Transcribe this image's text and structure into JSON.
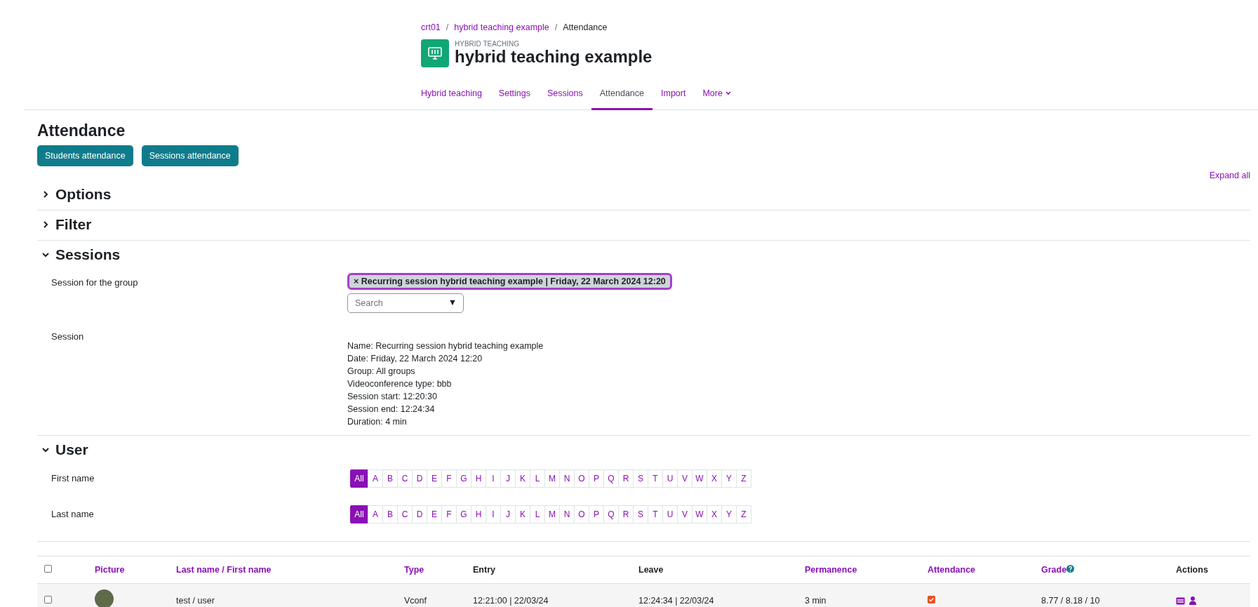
{
  "breadcrumb": [
    {
      "text": "crt01",
      "link": true
    },
    {
      "separator": "/",
      "text": "hybrid teaching example",
      "link": true
    },
    {
      "separator": "/",
      "text": "Attendance",
      "link": false
    }
  ],
  "module": {
    "kind_label": "HYBRID TEACHING",
    "title": "hybrid teaching example"
  },
  "nav": [
    {
      "label": "Hybrid teaching",
      "selected": false,
      "dropdown": false
    },
    {
      "label": "Settings",
      "selected": false,
      "dropdown": false
    },
    {
      "label": "Sessions",
      "selected": false,
      "dropdown": false
    },
    {
      "label": "Attendance",
      "selected": true,
      "dropdown": false
    },
    {
      "label": "Import",
      "selected": false,
      "dropdown": false
    },
    {
      "label": "More",
      "selected": false,
      "dropdown": true
    }
  ],
  "page_title": "Attendance",
  "buttons": [
    "Students attendance",
    "Sessions attendance"
  ],
  "expand_all": "Expand all",
  "sections": [
    {
      "title": "Options",
      "expanded": false
    },
    {
      "title": "Filter",
      "expanded": false
    },
    {
      "title": "Sessions",
      "expanded": true,
      "kind": "sessions"
    },
    {
      "title": "User",
      "expanded": true,
      "kind": "user"
    }
  ],
  "sessions": {
    "group_label": "Session for the group",
    "chip": "Recurring session hybrid teaching example | Friday, 22 March 2024 12:20",
    "chip_remove": "×",
    "search": {
      "placeholder": "Search"
    },
    "dropdown_arrow": "▼",
    "session_label": "Session",
    "details": [
      "Name: Recurring session hybrid teaching example",
      "Date: Friday, 22 March 2024 12:20",
      "Group: All groups",
      "Videoconference type: bbb",
      "Session start: 12:20:30",
      "Session end: 12:24:34",
      "Duration: 4 min"
    ]
  },
  "user": {
    "filters": [
      {
        "label": "First name",
        "letters": [
          {
            "text": "All",
            "selected": true
          },
          {
            "text": "A",
            "selected": false
          },
          {
            "text": "B",
            "selected": false
          },
          {
            "text": "C",
            "selected": false
          },
          {
            "text": "D",
            "selected": false
          },
          {
            "text": "E",
            "selected": false
          },
          {
            "text": "F",
            "selected": false
          },
          {
            "text": "G",
            "selected": false
          },
          {
            "text": "H",
            "selected": false
          },
          {
            "text": "I",
            "selected": false
          },
          {
            "text": "J",
            "selected": false
          },
          {
            "text": "K",
            "selected": false
          },
          {
            "text": "L",
            "selected": false
          },
          {
            "text": "M",
            "selected": false
          },
          {
            "text": "N",
            "selected": false
          },
          {
            "text": "O",
            "selected": false
          },
          {
            "text": "P",
            "selected": false
          },
          {
            "text": "Q",
            "selected": false
          },
          {
            "text": "R",
            "selected": false
          },
          {
            "text": "S",
            "selected": false
          },
          {
            "text": "T",
            "selected": false
          },
          {
            "text": "U",
            "selected": false
          },
          {
            "text": "V",
            "selected": false
          },
          {
            "text": "W",
            "selected": false
          },
          {
            "text": "X",
            "selected": false
          },
          {
            "text": "Y",
            "selected": false
          },
          {
            "text": "Z",
            "selected": false
          }
        ]
      },
      {
        "label": "Last name",
        "letters": [
          {
            "text": "All",
            "selected": true
          },
          {
            "text": "A",
            "selected": false
          },
          {
            "text": "B",
            "selected": false
          },
          {
            "text": "C",
            "selected": false
          },
          {
            "text": "D",
            "selected": false
          },
          {
            "text": "E",
            "selected": false
          },
          {
            "text": "F",
            "selected": false
          },
          {
            "text": "G",
            "selected": false
          },
          {
            "text": "H",
            "selected": false
          },
          {
            "text": "I",
            "selected": false
          },
          {
            "text": "J",
            "selected": false
          },
          {
            "text": "K",
            "selected": false
          },
          {
            "text": "L",
            "selected": false
          },
          {
            "text": "M",
            "selected": false
          },
          {
            "text": "N",
            "selected": false
          },
          {
            "text": "O",
            "selected": false
          },
          {
            "text": "P",
            "selected": false
          },
          {
            "text": "Q",
            "selected": false
          },
          {
            "text": "R",
            "selected": false
          },
          {
            "text": "S",
            "selected": false
          },
          {
            "text": "T",
            "selected": false
          },
          {
            "text": "U",
            "selected": false
          },
          {
            "text": "V",
            "selected": false
          },
          {
            "text": "W",
            "selected": false
          },
          {
            "text": "X",
            "selected": false
          },
          {
            "text": "Y",
            "selected": false
          },
          {
            "text": "Z",
            "selected": false
          }
        ]
      }
    ]
  },
  "table": {
    "select_all": {
      "checked": false
    },
    "columns": [
      {
        "label": "Picture",
        "sortable": true,
        "help": false
      },
      {
        "label": "Last name / First name",
        "sortable": true,
        "help": false
      },
      {
        "label": "Type",
        "sortable": true,
        "help": false
      },
      {
        "label": "Entry",
        "sortable": false,
        "help": false
      },
      {
        "label": "Leave",
        "sortable": false,
        "help": false
      },
      {
        "label": "Permanence",
        "sortable": true,
        "help": false
      },
      {
        "label": "Attendance",
        "sortable": true,
        "help": false
      },
      {
        "label": "Grade",
        "sortable": true,
        "help": true
      },
      {
        "label": "Actions",
        "sortable": false,
        "help": false
      }
    ],
    "rows": [
      {
        "checked": false,
        "name": "test / user",
        "type": "Vconf",
        "entry": "12:21:00 | 22/03/24",
        "leave": "12:24:34 | 22/03/24",
        "permanence": "3 min",
        "attendance": true,
        "grade": "8.77 / 8.18 / 10"
      }
    ]
  }
}
